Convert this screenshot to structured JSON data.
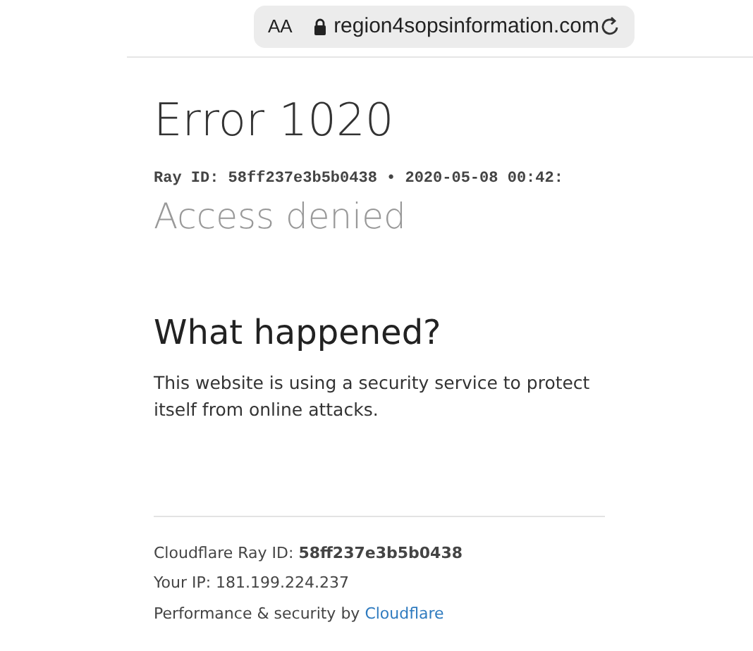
{
  "address_bar": {
    "text_size_button": "AA",
    "url": "region4sopsinformation.com"
  },
  "error_title": "Error 1020",
  "ray_line": "Ray ID: 58ff237e3b5b0438 • 2020-05-08 00:42:",
  "subtitle": "Access denied",
  "section_heading": "What happened?",
  "explanation": "This website is using a security service to protect itself from online attacks.",
  "footer": {
    "ray_id": "Cloudflare Ray ID: **58ff237e3b5b0438**",
    "ip": "Your IP: 181.199.224.237",
    "credit": "Performance & security by ",
    "credit_link": "Cloudflare"
  }
}
